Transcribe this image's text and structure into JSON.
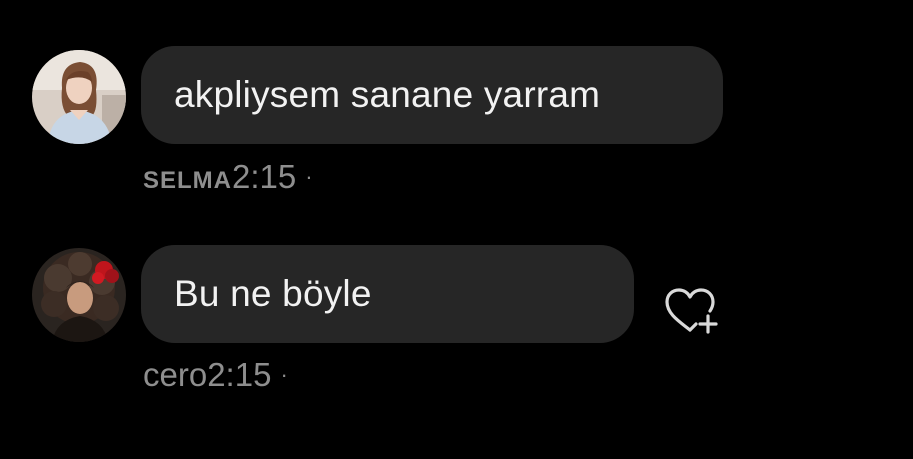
{
  "messages": [
    {
      "text": "akpliysem sanane yarram",
      "sender": "SELMA",
      "time": "2:15",
      "separator": "·",
      "avatar_icon": "avatar-photo"
    },
    {
      "text": "Bu ne böyle",
      "sender": "cero",
      "time": "2:15",
      "separator": "·",
      "avatar_icon": "avatar-photo",
      "reaction_icon": "heart-add-icon"
    }
  ],
  "colors": {
    "background": "#000000",
    "bubble": "#262626",
    "message_text": "#f2f2f2",
    "meta_text": "#8e8e8e",
    "icon": "#d9d9d9"
  }
}
